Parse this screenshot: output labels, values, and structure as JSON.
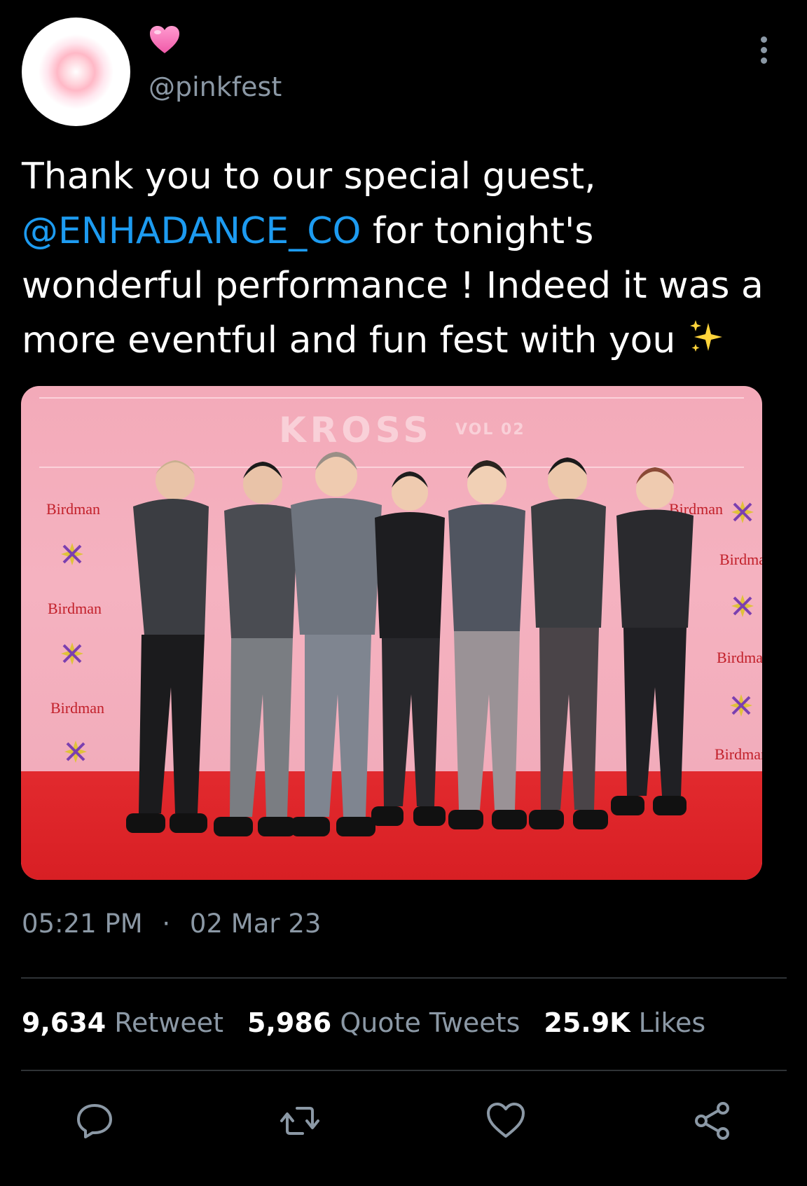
{
  "author": {
    "display_name_icon": "pink-heart-emoji",
    "handle": "@pinkfest",
    "avatar_icon": "glowing-heart-avatar"
  },
  "tweet": {
    "text_before": "Thank you to our special guest, ",
    "mention": "@ENHADANCE_CO",
    "text_after": " for tonight's wonderful performance ! Indeed it was a more eventful and fun fest with you ",
    "emoji": "sparkles-emoji"
  },
  "photo": {
    "description_icon": "group-photo",
    "logo_text": "KROSS",
    "logo_vol": "VOL 02",
    "sponsor_text": "Birdman"
  },
  "meta": {
    "time": "05:21 PM",
    "separator": "·",
    "date": "02 Mar 23"
  },
  "stats": {
    "retweets_count": "9,634",
    "retweets_label": "Retweet",
    "quotes_count": "5,986",
    "quotes_label": "Quote Tweets",
    "likes_count": "25.9K",
    "likes_label": "Likes"
  },
  "actions": [
    "reply-icon",
    "retweet-icon",
    "like-icon",
    "share-icon"
  ],
  "colors": {
    "background": "#000000",
    "text": "#ffffff",
    "secondary": "#8b98a5",
    "link": "#1d9bf0",
    "divider": "#2f3336"
  }
}
